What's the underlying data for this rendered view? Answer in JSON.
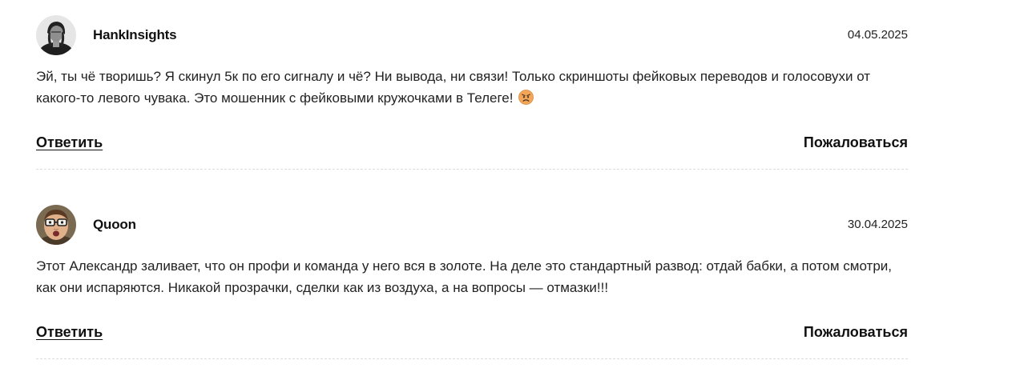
{
  "comments": [
    {
      "author": "HankInsights",
      "date": "04.05.2025",
      "text": "Эй, ты чё творишь? Я скинул 5к по его сигналу и чё? Ни вывода, ни связи! Только скриншоты фейковых переводов и голосовухи от какого-то левого чувака. Это мошенник с фейковыми кружочками в Телеге!",
      "emoji": "angry-face-icon",
      "reply_label": "Ответить",
      "report_label": "Пожаловаться",
      "avatar": "avatar-man-dark-hair"
    },
    {
      "author": "Quoon",
      "date": "30.04.2025",
      "text": "Этот Александр заливает, что он профи и команда у него вся в золоте. На деле это стандартный развод: отдай бабки, а потом смотри, как они испаряются. Никакой прозрачки, сделки как из воздуха, а на вопросы — отмазки!!!",
      "reply_label": "Ответить",
      "report_label": "Пожаловаться",
      "avatar": "avatar-man-glasses"
    }
  ]
}
